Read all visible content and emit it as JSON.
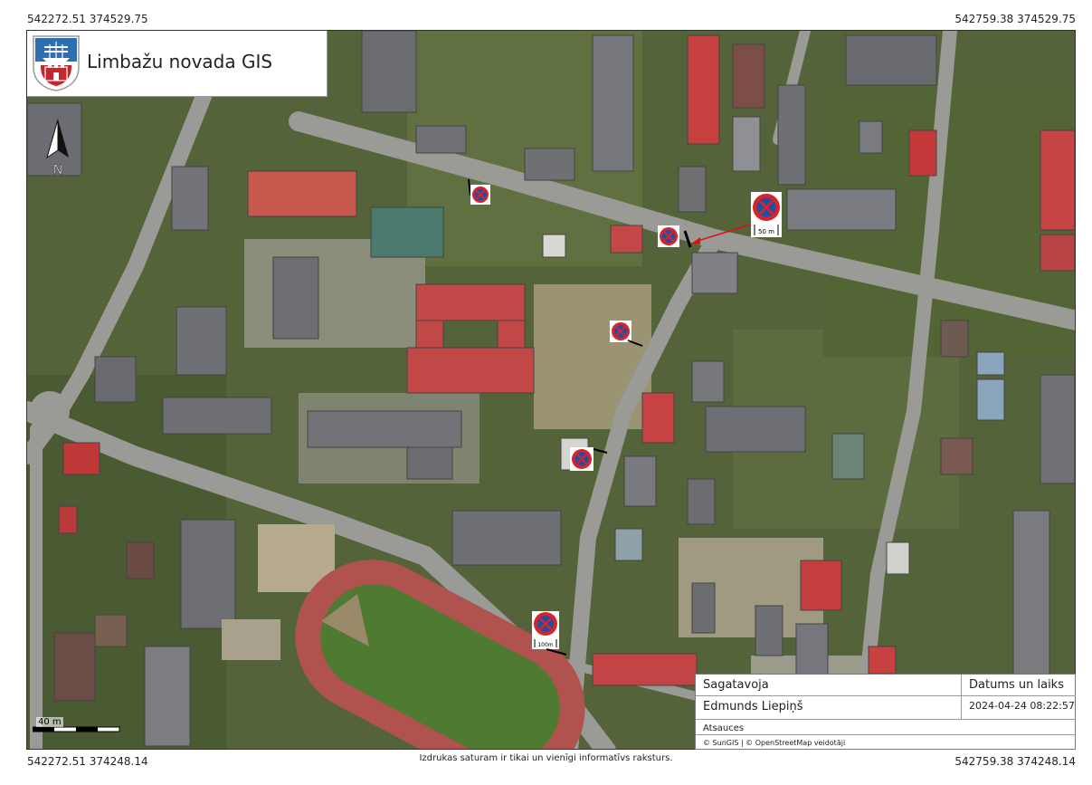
{
  "app": {
    "title": "Limbažu novada GIS"
  },
  "coords": {
    "top_left": "542272.51 374529.75",
    "top_right": "542759.38 374529.75",
    "bottom_left": "542272.51 374248.14",
    "bottom_right": "542759.38 374248.14"
  },
  "disclaimer": "Izdrukas saturam ir tikai un vienīgi informatīvs raksturs.",
  "north_arrow": {
    "label": "N"
  },
  "scale": {
    "label": "40 m"
  },
  "signs": {
    "distance_50": "50 m",
    "distance_100": "100m"
  },
  "info": {
    "prepared_header": "Sagatavoja",
    "date_header": "Datums un laiks",
    "prepared_by": "Edmunds Liepiņš",
    "datetime": "2024-04-24 08:22:57",
    "refs_header": "Atsauces",
    "refs": "© SunGIS | © OpenStreetMap veidotāji"
  },
  "colors": {
    "sign_red": "#d8232a",
    "sign_blue": "#1f4fa3",
    "arrow_red": "#e01010"
  }
}
